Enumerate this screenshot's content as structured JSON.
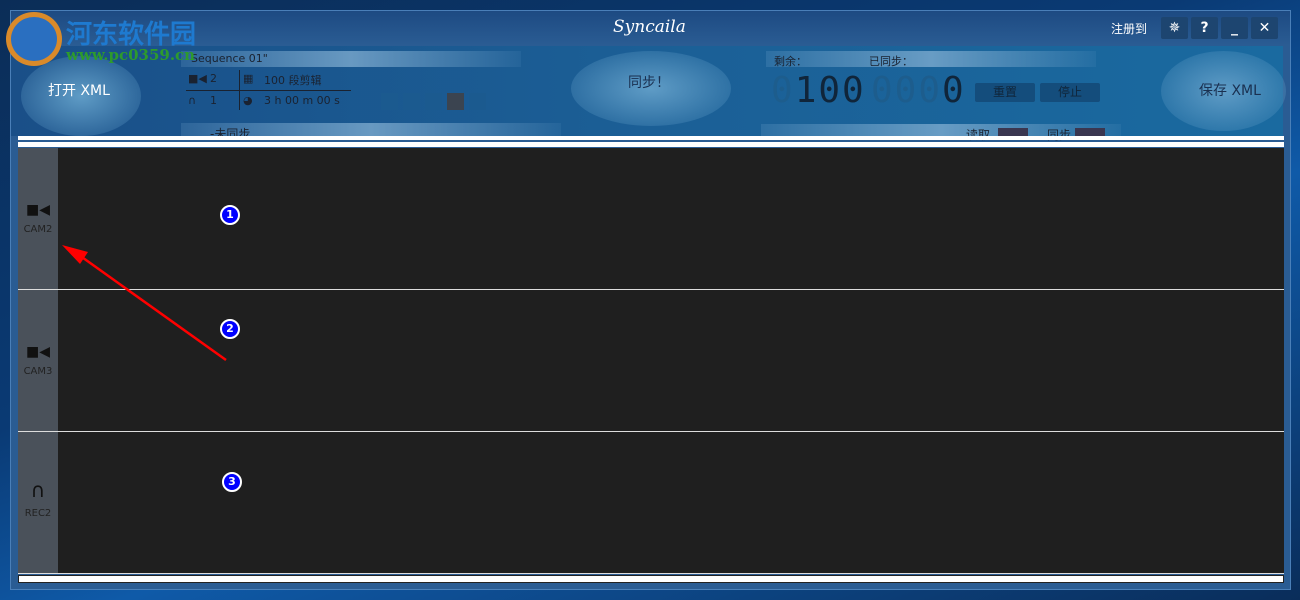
{
  "window": {
    "title": "Syncaila",
    "register_label": "注册到",
    "buttons": {
      "settings": "✵",
      "help": "?",
      "minimize": "_",
      "close": "✕"
    }
  },
  "watermark": {
    "name": "河东软件园",
    "url": "www.pc0359.cn"
  },
  "header": {
    "open_xml": "打开 XML",
    "save_xml": "保存 XML",
    "sync": "同步！",
    "sequence": "Sequence 01\"",
    "video_count": "2",
    "audio_count": "1",
    "clips": "100 段剪辑",
    "duration": "3 h 00 m 00 s",
    "status": "-未同步",
    "remaining_label": "剩余：",
    "synced_label": "已同步：",
    "remaining_value": "100",
    "synced_value": "0",
    "reset": "重置",
    "stop": "停止",
    "read_label": "读取",
    "sync_label": "同步",
    "indicator_colors": [
      "#1b5a8f",
      "#1b5a8f",
      "#1b5a8f",
      "#3b4450",
      "#1b5a8f"
    ]
  },
  "tracks": [
    {
      "label": "CAM2",
      "icon": "video-camera-icon",
      "marker": "1"
    },
    {
      "label": "CAM3",
      "icon": "video-camera-icon",
      "marker": "2"
    },
    {
      "label": "REC2",
      "icon": "headphones-icon",
      "marker": "3"
    }
  ],
  "annotation_color": "#ff0000"
}
